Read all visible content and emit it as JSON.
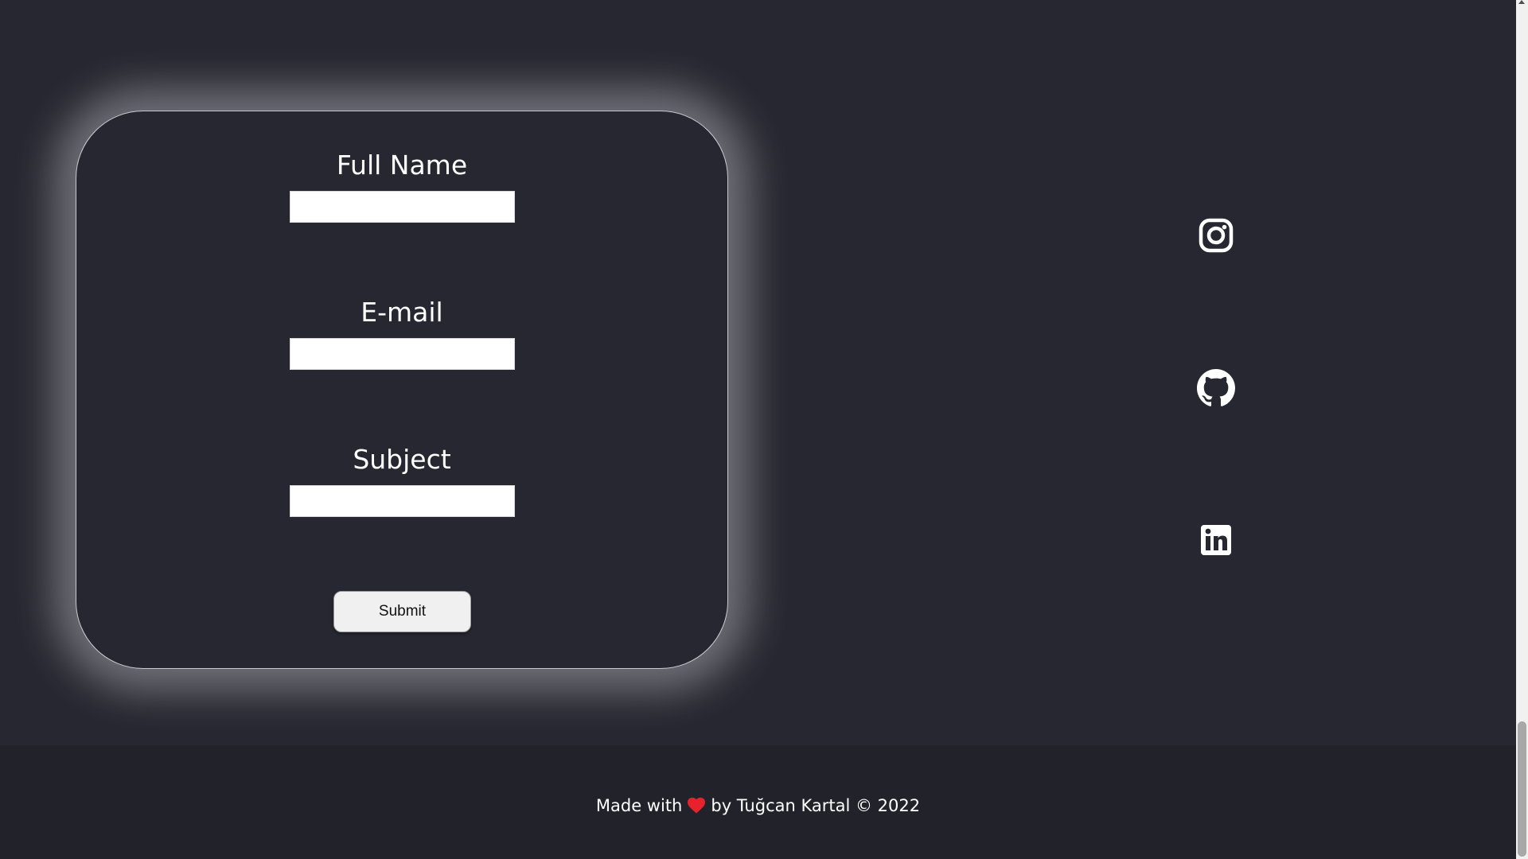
{
  "form": {
    "full_name_label": "Full Name",
    "full_name_value": "",
    "email_label": "E-mail",
    "email_value": "",
    "subject_label": "Subject",
    "subject_value": "",
    "submit_label": "Submit"
  },
  "social": {
    "icons": [
      "instagram-icon",
      "github-icon",
      "linkedin-icon"
    ]
  },
  "footer": {
    "made_with": "Made with",
    "by_text": "by Tuğcan Kartal © 2022",
    "heart_icon": "heart-icon"
  },
  "colors": {
    "background": "#272731",
    "footer_background": "#22222b",
    "text": "#ffffff",
    "heart": "#e8222d"
  }
}
